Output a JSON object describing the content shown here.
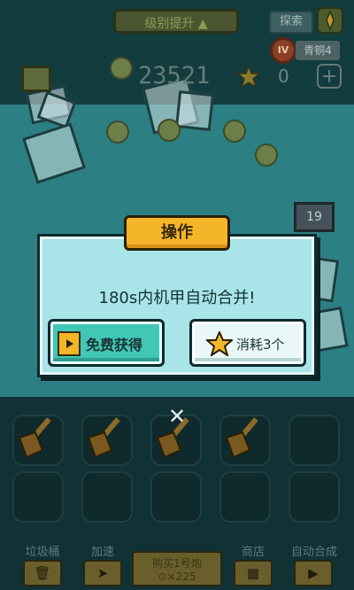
{
  "header": {
    "upgrade_label": "级别提升 ▲",
    "explore_label": "探索",
    "rank_icon_text": "IV",
    "rank_label": "青铜4",
    "coin_total": "23521",
    "star_count": "0",
    "plus_label": "+"
  },
  "field": {
    "level_tag": "19"
  },
  "dialog": {
    "title": "操作",
    "message": "180s内机甲自动合并!",
    "free_button_label": "免费获得",
    "cost_button_label": "消耗3个"
  },
  "toolbar": {
    "trash_label": "垃圾桶",
    "speed_label": "加速",
    "buy_title": "购买1号炮",
    "buy_cost": "⊙×225",
    "shop_label": "商店",
    "auto_merge_label": "自动合成"
  },
  "colors": {
    "accent_yellow": "#f4b529",
    "free_green": "#40c7b5",
    "dialog_bg": "#a8e4e8"
  }
}
